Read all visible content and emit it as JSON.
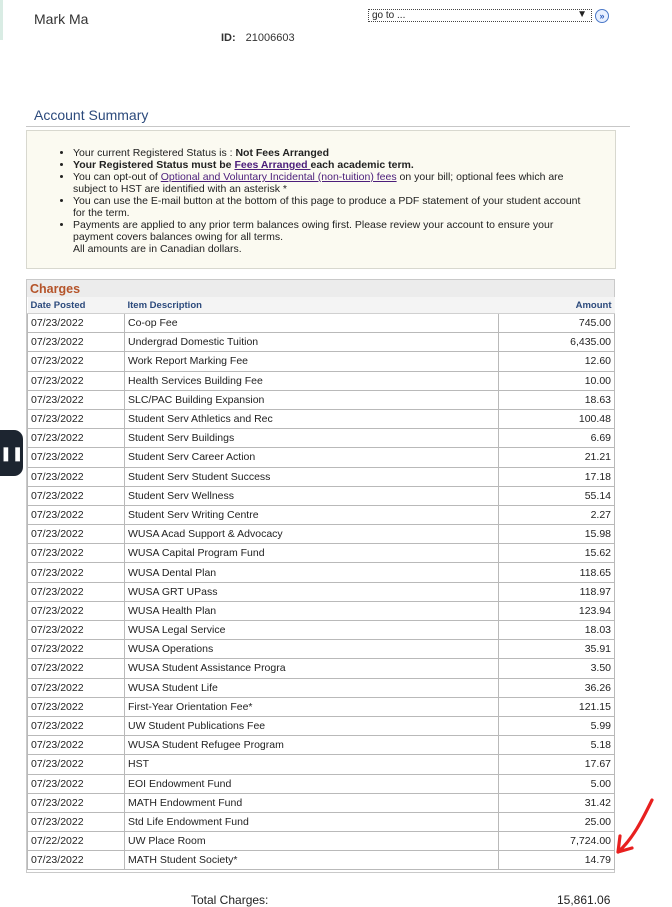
{
  "user": {
    "name": "Mark Ma",
    "id_label": "ID:",
    "id_value": "21006603"
  },
  "nav": {
    "goto_value": "go to ...",
    "go_label": "»"
  },
  "summary": {
    "title": "Account Summary",
    "bullets": [
      {
        "pre": "Your current Registered Status is : ",
        "bold": "Not Fees Arranged"
      },
      {
        "bold1": "Your Registered Status must be ",
        "link": "Fees Arranged ",
        "bold2": "each academic term."
      },
      {
        "pre": "You can opt-out of ",
        "link1": "Optional and Voluntary Incidental (non-tuition) fees",
        "post": " on your bill; optional fees which are subject to HST are identified with an asterisk *"
      },
      {
        "text": "You can use the E-mail button at the bottom of this page to produce a PDF statement of your student account for the term."
      },
      {
        "text": "Payments are applied to any prior term balances owing first. Please review your account to ensure your payment covers balances owing for all terms.",
        "note": "All amounts are in Canadian dollars."
      }
    ]
  },
  "charges": {
    "title": "Charges",
    "columns": [
      "Date Posted",
      "Item Description",
      "Amount"
    ],
    "rows": [
      {
        "date": "07/23/2022",
        "desc": "Co-op Fee",
        "amount": "745.00"
      },
      {
        "date": "07/23/2022",
        "desc": "Undergrad Domestic Tuition",
        "amount": "6,435.00"
      },
      {
        "date": "07/23/2022",
        "desc": "Work Report Marking Fee",
        "amount": "12.60"
      },
      {
        "date": "07/23/2022",
        "desc": "Health Services Building Fee",
        "amount": "10.00"
      },
      {
        "date": "07/23/2022",
        "desc": "SLC/PAC Building Expansion",
        "amount": "18.63"
      },
      {
        "date": "07/23/2022",
        "desc": "Student Serv Athletics and Rec",
        "amount": "100.48"
      },
      {
        "date": "07/23/2022",
        "desc": "Student Serv Buildings",
        "amount": "6.69"
      },
      {
        "date": "07/23/2022",
        "desc": "Student Serv Career Action",
        "amount": "21.21"
      },
      {
        "date": "07/23/2022",
        "desc": "Student Serv Student Success",
        "amount": "17.18"
      },
      {
        "date": "07/23/2022",
        "desc": "Student Serv Wellness",
        "amount": "55.14"
      },
      {
        "date": "07/23/2022",
        "desc": "Student Serv Writing Centre",
        "amount": "2.27"
      },
      {
        "date": "07/23/2022",
        "desc": "WUSA Acad Support & Advocacy",
        "amount": "15.98"
      },
      {
        "date": "07/23/2022",
        "desc": "WUSA Capital Program Fund",
        "amount": "15.62"
      },
      {
        "date": "07/23/2022",
        "desc": "WUSA Dental Plan",
        "amount": "118.65"
      },
      {
        "date": "07/23/2022",
        "desc": "WUSA GRT UPass",
        "amount": "118.97"
      },
      {
        "date": "07/23/2022",
        "desc": "WUSA Health Plan",
        "amount": "123.94"
      },
      {
        "date": "07/23/2022",
        "desc": "WUSA Legal Service",
        "amount": "18.03"
      },
      {
        "date": "07/23/2022",
        "desc": "WUSA Operations",
        "amount": "35.91"
      },
      {
        "date": "07/23/2022",
        "desc": "WUSA Student Assistance Progra",
        "amount": "3.50"
      },
      {
        "date": "07/23/2022",
        "desc": "WUSA Student Life",
        "amount": "36.26"
      },
      {
        "date": "07/23/2022",
        "desc": "First-Year Orientation Fee*",
        "amount": "121.15"
      },
      {
        "date": "07/23/2022",
        "desc": "UW Student Publications Fee",
        "amount": "5.99"
      },
      {
        "date": "07/23/2022",
        "desc": "WUSA Student Refugee Program",
        "amount": "5.18"
      },
      {
        "date": "07/23/2022",
        "desc": "HST",
        "amount": "17.67"
      },
      {
        "date": "07/23/2022",
        "desc": "EOI Endowment Fund",
        "amount": "5.00"
      },
      {
        "date": "07/23/2022",
        "desc": "MATH Endowment Fund",
        "amount": "31.42"
      },
      {
        "date": "07/23/2022",
        "desc": "Std Life Endowment Fund",
        "amount": "25.00"
      },
      {
        "date": "07/22/2022",
        "desc": "UW Place Room",
        "amount": "7,724.00"
      },
      {
        "date": "07/23/2022",
        "desc": "MATH Student Society*",
        "amount": "14.79"
      }
    ],
    "total_label": "Total Charges:",
    "total_value": "15,861.06"
  },
  "colors": {
    "section_title": "#2c4a7c",
    "charges_title": "#b5542a",
    "annotation": "#e8201f",
    "link": "#4b1d7a"
  }
}
